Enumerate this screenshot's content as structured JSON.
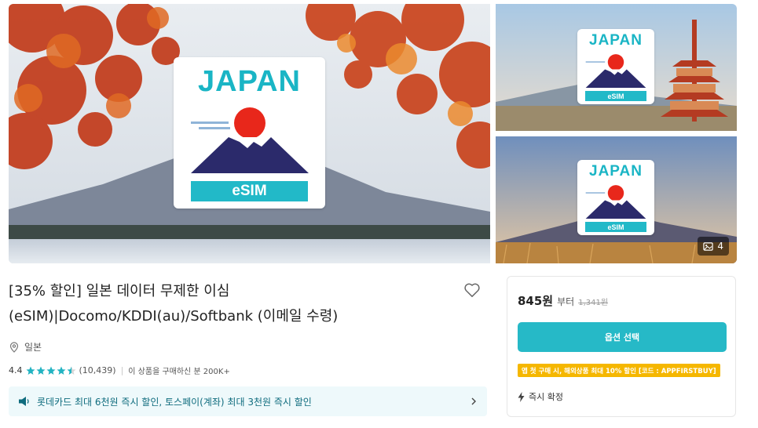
{
  "gallery": {
    "main_card": {
      "brand": "JAPAN",
      "label": "eSIM"
    },
    "thumb1_card": {
      "brand": "JAPAN",
      "label": "eSIM"
    },
    "thumb2_card": {
      "brand": "JAPAN",
      "label": "eSIM"
    },
    "photo_count": "4",
    "colors": {
      "card_accent": "#22b9c8",
      "sun": "#e8271b",
      "mountain": "#2b2a6b"
    }
  },
  "product": {
    "title_line1": "[35% 할인] 일본 데이터 무제한 이심",
    "title_line2": "(eSIM)|Docomo/KDDI(au)/Softbank (이메일 수령)",
    "location": "일본",
    "rating": 4.4,
    "rating_text": "4.4",
    "review_count": "(10,439)",
    "purchase_info": "이 상품을 구매하신 분 200K+"
  },
  "promo": {
    "text": "롯데카드 최대 6천원 즉시 할인, 토스페이(계좌) 최대 3천원 즉시 할인"
  },
  "booking": {
    "price": "845원",
    "price_suffix": "부터",
    "original_price": "1,341원",
    "select_button": "옵션 선택",
    "coupon_text": "앱 첫 구매 시, 해외상품 최대 10% 할인 [코드 : APPFIRSTBUY]",
    "instant_confirm": "즉시 확정",
    "colors": {
      "button": "#26b9c7",
      "coupon": "#f5b700"
    }
  }
}
